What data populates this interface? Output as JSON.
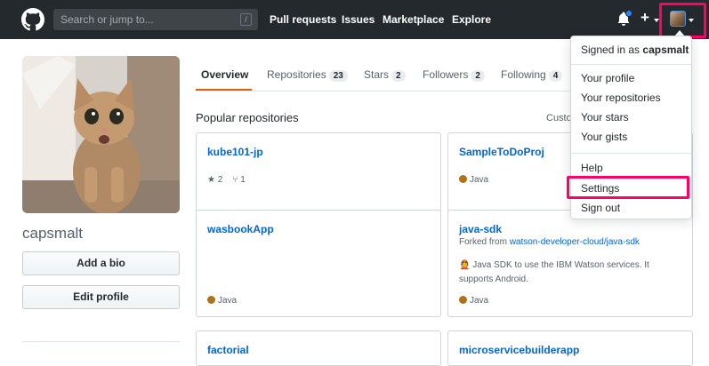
{
  "header": {
    "search_placeholder": "Search or jump to...",
    "search_shortcut": "/",
    "nav": [
      "Pull requests",
      "Issues",
      "Marketplace",
      "Explore"
    ],
    "plus": "+"
  },
  "profile": {
    "username": "capsmalt",
    "add_bio": "Add a bio",
    "edit_profile": "Edit profile"
  },
  "tabs": [
    {
      "label": "Overview",
      "count": null
    },
    {
      "label": "Repositories",
      "count": "23"
    },
    {
      "label": "Stars",
      "count": "2"
    },
    {
      "label": "Followers",
      "count": "2"
    },
    {
      "label": "Following",
      "count": "4"
    }
  ],
  "section_title": "Popular repositories",
  "customize_label": "Custo",
  "repos": [
    {
      "name": "kube101-jp",
      "stars": "2",
      "forks": "1"
    },
    {
      "name": "SampleToDoProj",
      "language": "Java"
    },
    {
      "name": "wasbookApp",
      "language": "Java"
    },
    {
      "name": "java-sdk",
      "forked_prefix": "Forked from",
      "forked_from": "watson-developer-cloud/java-sdk",
      "description_emoji": "👲",
      "description": "Java SDK to use the IBM Watson services. It supports Android.",
      "language": "Java"
    },
    {
      "name": "factorial"
    },
    {
      "name": "microservicebuilderapp"
    }
  ],
  "menu": {
    "signed_in_prefix": "Signed in as",
    "signed_in_user": "capsmalt",
    "items_1": [
      "Your profile",
      "Your repositories",
      "Your stars",
      "Your gists"
    ],
    "items_2": [
      "Help",
      "Settings",
      "Sign out"
    ]
  },
  "colors": {
    "header_bg": "#24292e",
    "highlight": "#ff0066",
    "link": "#0366d6",
    "java": "#b07219",
    "tab_accent": "#e36209"
  }
}
